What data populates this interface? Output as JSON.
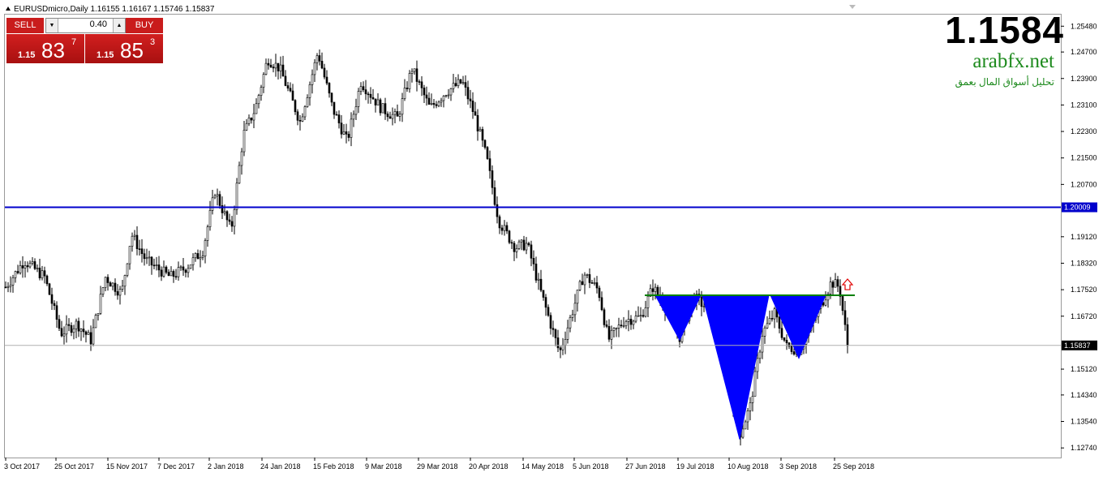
{
  "header": {
    "symbol_info": "EURUSDmicro,Daily  1.16155 1.16167 1.15746 1.15837",
    "big_price": "1.1584",
    "site_name": "arabfx.net",
    "site_tagline": "تحليل أسواق المال بعمق"
  },
  "trade_panel": {
    "sell_label": "SELL",
    "buy_label": "BUY",
    "lot_size": "0.40",
    "sell_pre": "1.15",
    "sell_mid": "83",
    "sell_sup": "7",
    "buy_pre": "1.15",
    "buy_mid": "85",
    "buy_sup": "3"
  },
  "colors": {
    "resistance_line": "#0000cc",
    "neckline": "#008000",
    "pattern_fill": "#0000ff",
    "bull_candle": "#ffffff",
    "bear_candle": "#000000",
    "arrow": "#e00000"
  },
  "chart_data": {
    "type": "candlestick",
    "ylim": [
      1.1245,
      1.2583
    ],
    "y_ticks": [
      "1.25480",
      "1.24700",
      "1.23900",
      "1.23100",
      "1.22300",
      "1.21500",
      "1.20700",
      "1.19120",
      "1.18320",
      "1.17520",
      "1.16720",
      "1.15120",
      "1.14340",
      "1.13540",
      "1.12740"
    ],
    "x_ticks": [
      "3 Oct 2017",
      "25 Oct 2017",
      "15 Nov 2017",
      "7 Dec 2017",
      "2 Jan 2018",
      "24 Jan 2018",
      "15 Feb 2018",
      "9 Mar 2018",
      "29 Mar 2018",
      "20 Apr 2018",
      "14 May 2018",
      "5 Jun 2018",
      "27 Jun 2018",
      "19 Jul 2018",
      "10 Aug 2018",
      "3 Sep 2018",
      "25 Sep 2018"
    ],
    "horizontal_lines": [
      {
        "value": 1.20009,
        "label": "1.20009",
        "style": "resistance"
      },
      {
        "value": 1.15837,
        "label": "1.15837",
        "style": "current"
      }
    ],
    "neckline": {
      "from": "27 Jun 2018",
      "to": "25 Sep 2018",
      "value": 1.1735
    },
    "pattern": {
      "name": "inverse head and shoulders",
      "left_shoulder_low": 1.16,
      "head_low": 1.13,
      "right_shoulder_low": 1.1545
    },
    "ohlc_anchor": [
      {
        "date": "3 Oct 2017",
        "close": 1.176
      },
      {
        "date": "25 Oct 2017",
        "close": 1.163
      },
      {
        "date": "15 Nov 2017",
        "close": 1.179
      },
      {
        "date": "7 Dec 2017",
        "close": 1.178
      },
      {
        "date": "2 Jan 2018",
        "close": 1.205
      },
      {
        "date": "24 Jan 2018",
        "close": 1.242
      },
      {
        "date": "15 Feb 2018",
        "close": 1.246
      },
      {
        "date": "9 Mar 2018",
        "close": 1.231
      },
      {
        "date": "29 Mar 2018",
        "close": 1.231
      },
      {
        "date": "20 Apr 2018",
        "close": 1.208
      },
      {
        "date": "14 May 2018",
        "close": 1.18
      },
      {
        "date": "5 Jun 2018",
        "close": 1.172
      },
      {
        "date": "27 Jun 2018",
        "close": 1.166
      },
      {
        "date": "19 Jul 2018",
        "close": 1.166
      },
      {
        "date": "10 Aug 2018",
        "close": 1.14
      },
      {
        "date": "3 Sep 2018",
        "close": 1.162
      },
      {
        "date": "25 Sep 2018",
        "close": 1.1584
      }
    ]
  }
}
